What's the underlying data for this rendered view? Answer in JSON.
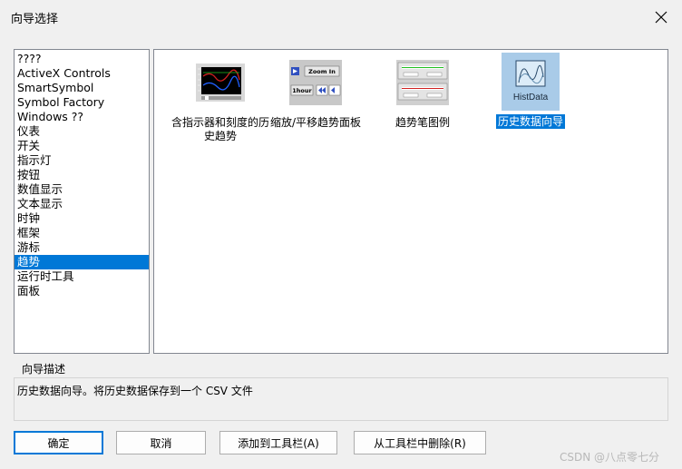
{
  "window": {
    "title": "向导选择"
  },
  "category_list": {
    "items": [
      "????",
      "ActiveX Controls",
      "SmartSymbol",
      "Symbol Factory",
      "Windows ??",
      "仪表",
      "开关",
      "指示灯",
      "按钮",
      "数值显示",
      "文本显示",
      "时钟",
      "框架",
      "游标",
      "趋势",
      "运行时工具",
      "面板"
    ],
    "selected_index": 14
  },
  "wizards": [
    {
      "caption": "含指示器和刻度的历史趋势",
      "icon": "indicator-trend-icon",
      "selected": false
    },
    {
      "caption": "缩放/平移趋势面板",
      "icon": "zoom-pan-panel-icon",
      "zoom_text": "Zoom In",
      "hour_text": "1hour",
      "selected": false
    },
    {
      "caption": "趋势笔图例",
      "icon": "pen-legend-icon",
      "selected": false
    },
    {
      "caption": "历史数据向导",
      "icon": "histdata-icon",
      "icon_label": "HistData",
      "selected": true
    }
  ],
  "description": {
    "label": "向导描述",
    "text": "历史数据向导。将历史数据保存到一个 CSV 文件"
  },
  "buttons": {
    "ok": "确定",
    "cancel": "取消",
    "add_toolbar": "添加到工具栏(A)",
    "remove_toolbar": "从工具栏中删除(R)"
  },
  "watermark": "CSDN @八点零七分",
  "colors": {
    "selection": "#0078d7",
    "selected_icon_bg": "#a9cbe8",
    "plot_bg": "#000000"
  }
}
